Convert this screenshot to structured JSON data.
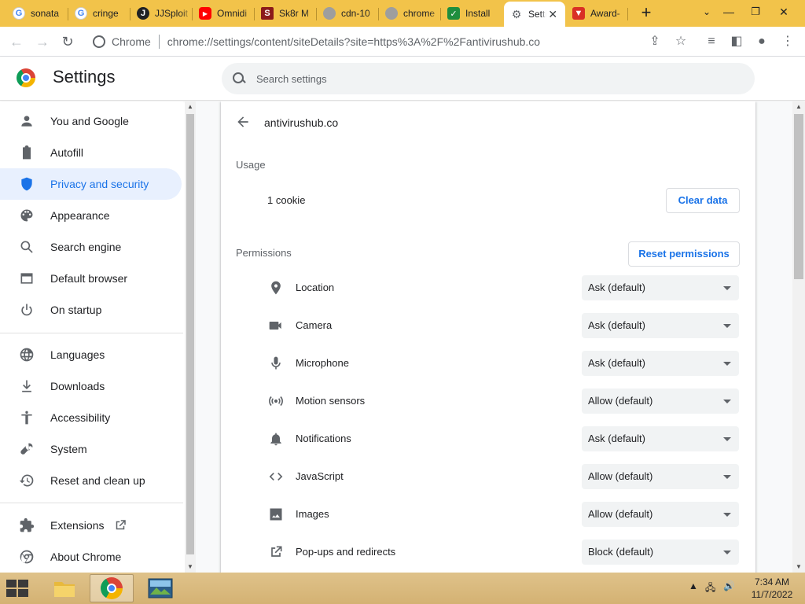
{
  "tabs": [
    {
      "title": "sonata",
      "favicon": "google-icon",
      "color": "#4285f4"
    },
    {
      "title": "cringe",
      "favicon": "google-icon",
      "color": "#4285f4"
    },
    {
      "title": "JJSploit",
      "favicon": "jjsploit-icon",
      "color": "#202124"
    },
    {
      "title": "Omnidi",
      "favicon": "youtube-icon",
      "color": "#ff0000"
    },
    {
      "title": "Sk8r M",
      "favicon": "sk8r-icon",
      "color": "#8b1a1a"
    },
    {
      "title": "cdn-10",
      "favicon": "globe-icon",
      "color": "#7a7a7a"
    },
    {
      "title": "chrome",
      "favicon": "globe-icon",
      "color": "#7a7a7a"
    },
    {
      "title": "Install",
      "favicon": "shield-check-icon",
      "color": "#1e8e3e"
    },
    {
      "title": "Setti",
      "favicon": "gear-icon",
      "color": "#5f6368",
      "active": true
    },
    {
      "title": "Award-",
      "favicon": "brave-shield-icon",
      "color": "#d93025"
    }
  ],
  "omnibox": {
    "site_label": "Chrome",
    "url": "chrome://settings/content/siteDetails?site=https%3A%2F%2Fantivirushub.co"
  },
  "header": {
    "title": "Settings",
    "search_placeholder": "Search settings"
  },
  "sidebar": {
    "items": [
      {
        "label": "You and Google",
        "icon": "person-icon"
      },
      {
        "label": "Autofill",
        "icon": "clipboard-icon"
      },
      {
        "label": "Privacy and security",
        "icon": "shield-icon",
        "active": true
      },
      {
        "label": "Appearance",
        "icon": "palette-icon"
      },
      {
        "label": "Search engine",
        "icon": "search-icon"
      },
      {
        "label": "Default browser",
        "icon": "browser-icon"
      },
      {
        "label": "On startup",
        "icon": "power-icon"
      },
      {
        "label": "Languages",
        "icon": "globe-icon"
      },
      {
        "label": "Downloads",
        "icon": "download-icon"
      },
      {
        "label": "Accessibility",
        "icon": "accessibility-icon"
      },
      {
        "label": "System",
        "icon": "wrench-icon"
      },
      {
        "label": "Reset and clean up",
        "icon": "restore-icon"
      },
      {
        "label": "Extensions",
        "icon": "puzzle-icon"
      },
      {
        "label": "About Chrome",
        "icon": "chrome-icon"
      }
    ]
  },
  "site": {
    "name": "antivirushub.co",
    "usage_label": "Usage",
    "cookies": "1 cookie",
    "clear_data": "Clear data",
    "permissions_label": "Permissions",
    "reset_permissions": "Reset permissions"
  },
  "permissions": [
    {
      "label": "Location",
      "value": "Ask (default)",
      "icon": "location-pin-icon"
    },
    {
      "label": "Camera",
      "value": "Ask (default)",
      "icon": "camera-icon"
    },
    {
      "label": "Microphone",
      "value": "Ask (default)",
      "icon": "microphone-icon"
    },
    {
      "label": "Motion sensors",
      "value": "Allow (default)",
      "icon": "motion-sensor-icon"
    },
    {
      "label": "Notifications",
      "value": "Ask (default)",
      "icon": "bell-icon"
    },
    {
      "label": "JavaScript",
      "value": "Allow (default)",
      "icon": "code-icon"
    },
    {
      "label": "Images",
      "value": "Allow (default)",
      "icon": "image-icon"
    },
    {
      "label": "Pop-ups and redirects",
      "value": "Block (default)",
      "icon": "open-in-new-icon"
    }
  ],
  "taskbar": {
    "time": "7:34 AM",
    "date": "11/7/2022"
  },
  "colors": {
    "accent": "#1a73e8",
    "tabstrip": "#f2c34a",
    "taskbar": "#d9b87c"
  }
}
